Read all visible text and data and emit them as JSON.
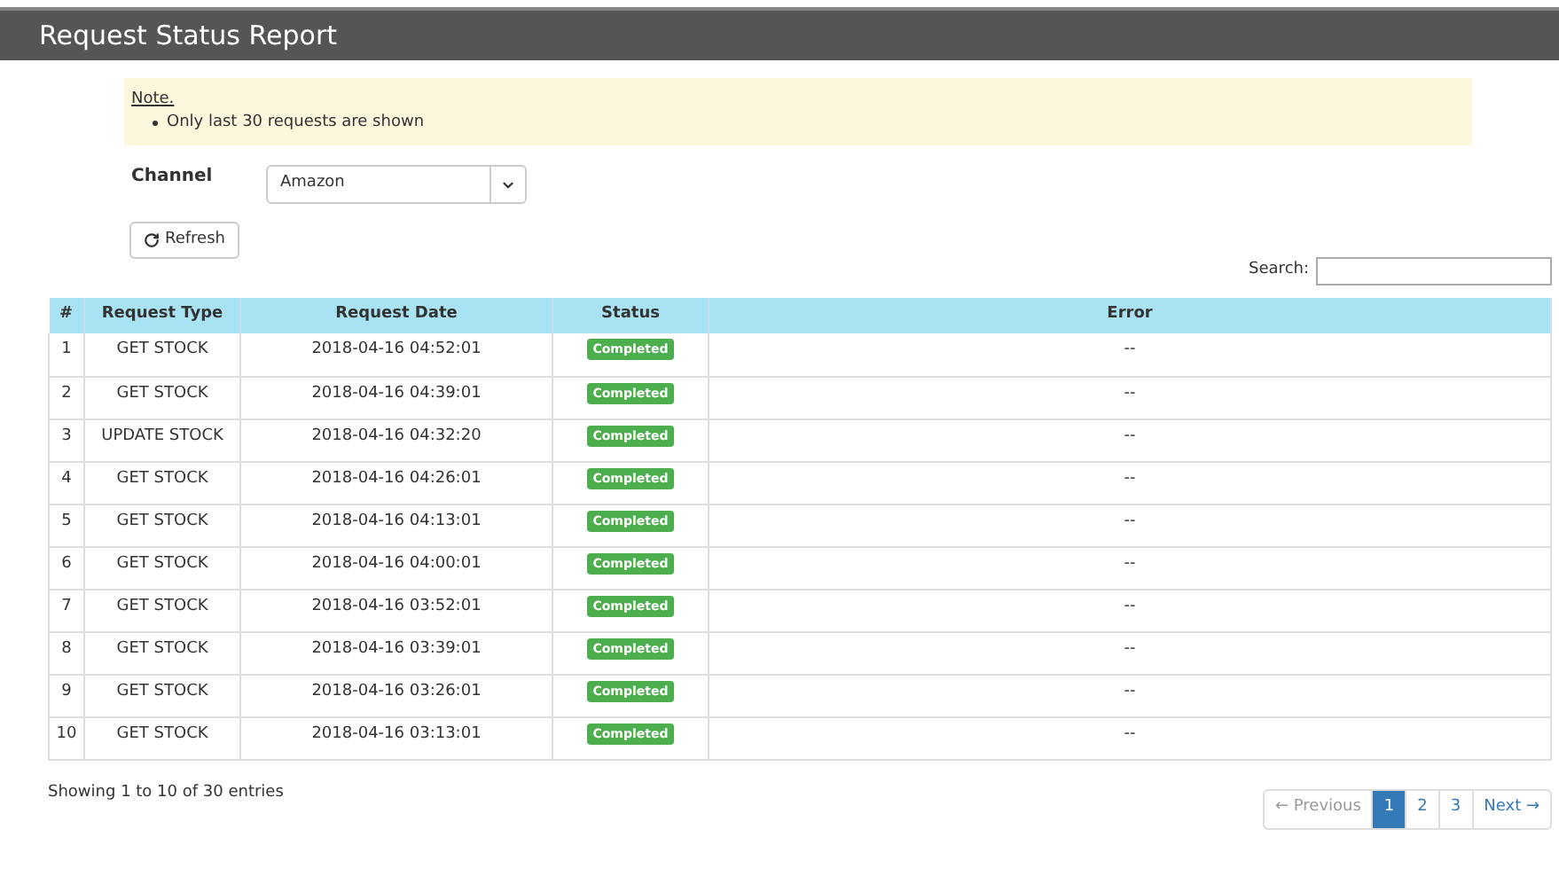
{
  "header": {
    "title": "Request Status Report"
  },
  "note": {
    "title": "Note.",
    "items": [
      "Only last 30 requests are shown"
    ]
  },
  "channel": {
    "label": "Channel",
    "value": "Amazon"
  },
  "refresh_button": {
    "label": "Refresh"
  },
  "search": {
    "label": "Search:"
  },
  "table": {
    "columns": [
      "#",
      "Request Type",
      "Request Date",
      "Status",
      "Error"
    ],
    "rows": [
      {
        "index": "1",
        "type": "GET STOCK",
        "date": "2018-04-16 04:52:01",
        "status": "Completed",
        "error": "--"
      },
      {
        "index": "2",
        "type": "GET STOCK",
        "date": "2018-04-16 04:39:01",
        "status": "Completed",
        "error": "--"
      },
      {
        "index": "3",
        "type": "UPDATE STOCK",
        "date": "2018-04-16 04:32:20",
        "status": "Completed",
        "error": "--"
      },
      {
        "index": "4",
        "type": "GET STOCK",
        "date": "2018-04-16 04:26:01",
        "status": "Completed",
        "error": "--"
      },
      {
        "index": "5",
        "type": "GET STOCK",
        "date": "2018-04-16 04:13:01",
        "status": "Completed",
        "error": "--"
      },
      {
        "index": "6",
        "type": "GET STOCK",
        "date": "2018-04-16 04:00:01",
        "status": "Completed",
        "error": "--"
      },
      {
        "index": "7",
        "type": "GET STOCK",
        "date": "2018-04-16 03:52:01",
        "status": "Completed",
        "error": "--"
      },
      {
        "index": "8",
        "type": "GET STOCK",
        "date": "2018-04-16 03:39:01",
        "status": "Completed",
        "error": "--"
      },
      {
        "index": "9",
        "type": "GET STOCK",
        "date": "2018-04-16 03:26:01",
        "status": "Completed",
        "error": "--"
      },
      {
        "index": "10",
        "type": "GET STOCK",
        "date": "2018-04-16 03:13:01",
        "status": "Completed",
        "error": "--"
      }
    ]
  },
  "info": "Showing 1 to 10 of 30 entries",
  "pagination": [
    {
      "label": "← Previous",
      "disabled": true,
      "selected": false
    },
    {
      "label": "1",
      "disabled": false,
      "selected": true
    },
    {
      "label": "2",
      "disabled": false,
      "selected": false
    },
    {
      "label": "3",
      "disabled": false,
      "selected": false
    },
    {
      "label": "Next →",
      "disabled": false,
      "selected": false
    }
  ]
}
